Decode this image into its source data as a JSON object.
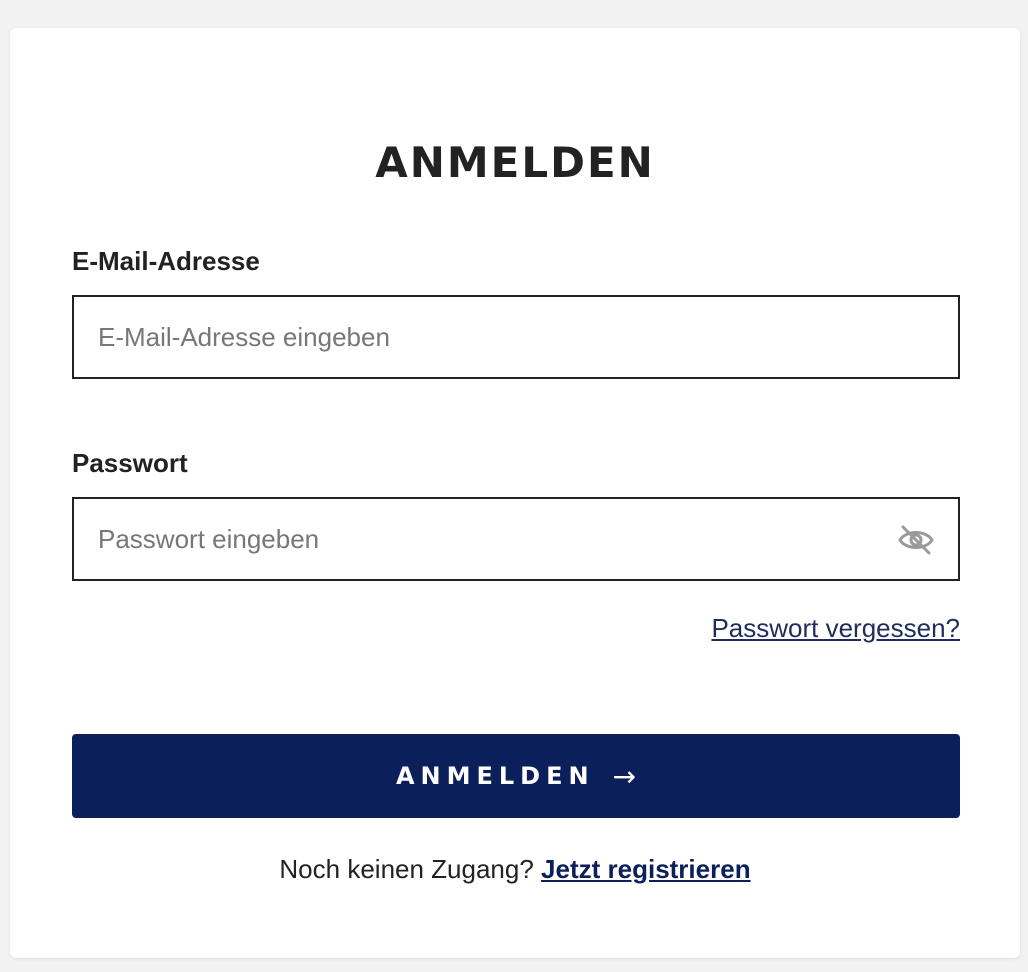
{
  "login": {
    "title": "ANMELDEN",
    "email": {
      "label": "E-Mail-Adresse",
      "placeholder": "E-Mail-Adresse eingeben",
      "value": ""
    },
    "password": {
      "label": "Passwort",
      "placeholder": "Passwort eingeben",
      "value": "",
      "toggle_icon": "eye-off-icon"
    },
    "forgot_link": "Passwort vergessen?",
    "submit": {
      "label": "ANMELDEN",
      "arrow": "→",
      "icon": "arrow-right-icon"
    },
    "register": {
      "prompt": "Noch keinen Zugang?",
      "link": "Jetzt registrieren"
    }
  },
  "colors": {
    "primary": "#0b1f5a",
    "text": "#222222",
    "placeholder": "#777777",
    "background": "#f2f2f2"
  }
}
